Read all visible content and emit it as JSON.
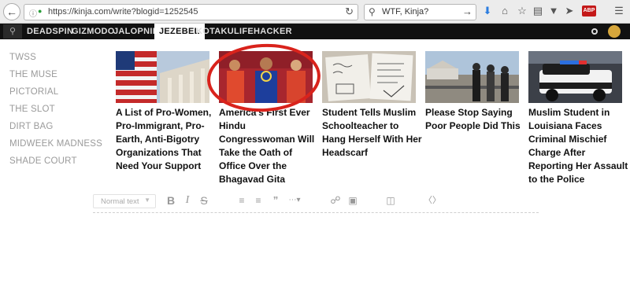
{
  "browser": {
    "url": "https://kinja.com/write?blogid=1252545",
    "search_query": "WTF, Kinja?"
  },
  "nav": {
    "items": [
      "DEADSPIN",
      "GIZMODO",
      "JALOPNIK",
      "JEZEBEL",
      "KOTAKU",
      "LIFEHACKER"
    ],
    "active": "JEZEBEL"
  },
  "sidebar": {
    "links": [
      "TWSS",
      "THE MUSE",
      "PICTORIAL",
      "THE SLOT",
      "DIRT BAG",
      "MIDWEEK MADNESS",
      "SHADE COURT"
    ]
  },
  "stories": [
    {
      "headline": "A List of Pro-Women, Pro-Immigrant, Pro-Earth, Anti-Bigotry Organizations That Need Your Support"
    },
    {
      "headline": "America's First Ever Hindu Congresswoman Will Take the Oath of Office Over the Bhagavad Gita"
    },
    {
      "headline": "Student Tells Muslim Schoolteacher to Hang Herself With Her Headscarf"
    },
    {
      "headline": "Please Stop Saying Poor People Did This"
    },
    {
      "headline": "Muslim Student in Louisiana Faces Criminal Mischief Charge After Reporting Her Assault to the Police"
    }
  ],
  "editor": {
    "format_value": "Normal text"
  },
  "colors": {
    "nav_bg": "#111111",
    "annotation_circle": "#d9231c"
  }
}
